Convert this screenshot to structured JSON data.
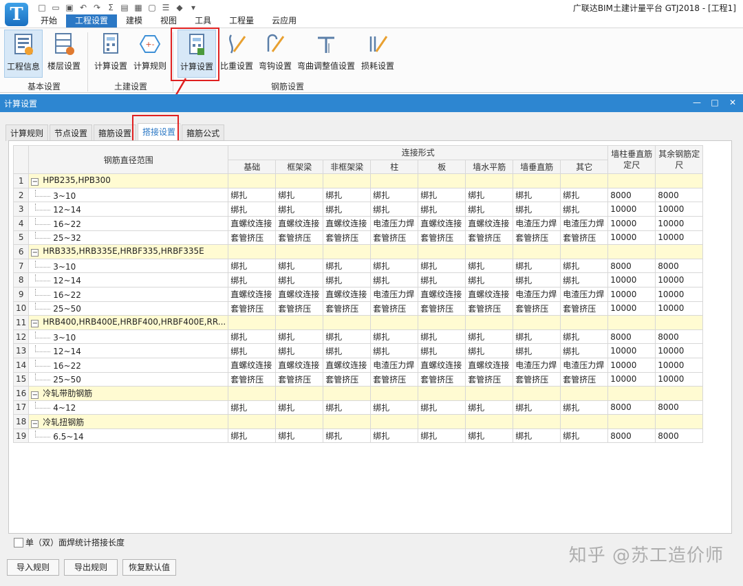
{
  "app": {
    "title": "广联达BIM土建计量平台 GTJ2018 - [工程1]",
    "logo_letter": "T",
    "menu_tabs": [
      "开始",
      "工程设置",
      "建模",
      "视图",
      "工具",
      "工程量",
      "云应用"
    ],
    "active_menu_tab": "工程设置"
  },
  "ribbon": {
    "buttons": [
      {
        "label": "工程信息",
        "icon": "project-info-icon"
      },
      {
        "label": "楼层设置",
        "icon": "floor-settings-icon"
      },
      {
        "label": "计算设置",
        "icon": "calc-settings-icon"
      },
      {
        "label": "计算规则",
        "icon": "calc-rules-icon"
      },
      {
        "label": "计算设置",
        "icon": "rebar-calc-settings-icon"
      },
      {
        "label": "比重设置",
        "icon": "density-settings-icon"
      },
      {
        "label": "弯钩设置",
        "icon": "hook-settings-icon"
      },
      {
        "label": "弯曲调整值设置",
        "icon": "bend-adjust-icon"
      },
      {
        "label": "损耗设置",
        "icon": "loss-settings-icon"
      }
    ],
    "groups": [
      "基本设置",
      "土建设置",
      "钢筋设置"
    ]
  },
  "dialog": {
    "title": "计算设置",
    "tabs": [
      "计算规则",
      "节点设置",
      "箍筋设置",
      "搭接设置",
      "箍筋公式"
    ],
    "active_tab": "搭接设置",
    "header": {
      "range_col": "钢筋直径范围",
      "conn_group": "连接形式",
      "conn_cols": [
        "基础",
        "框架梁",
        "非框架梁",
        "柱",
        "板",
        "墙水平筋",
        "墙垂直筋",
        "其它"
      ],
      "wall_col_l1": "墙柱垂直筋",
      "wall_col_l2": "定尺",
      "other_col_l1": "其余钢筋定",
      "other_col_l2": "尺"
    },
    "rows": [
      {
        "n": "1",
        "group": true,
        "name": "HPB235,HPB300"
      },
      {
        "n": "2",
        "name": "3~10",
        "vals": [
          "绑扎",
          "绑扎",
          "绑扎",
          "绑扎",
          "绑扎",
          "绑扎",
          "绑扎",
          "绑扎",
          "8000",
          "8000"
        ]
      },
      {
        "n": "3",
        "name": "12~14",
        "vals": [
          "绑扎",
          "绑扎",
          "绑扎",
          "绑扎",
          "绑扎",
          "绑扎",
          "绑扎",
          "绑扎",
          "10000",
          "10000"
        ]
      },
      {
        "n": "4",
        "name": "16~22",
        "vals": [
          "直螺纹连接",
          "直螺纹连接",
          "直螺纹连接",
          "电渣压力焊",
          "直螺纹连接",
          "直螺纹连接",
          "电渣压力焊",
          "电渣压力焊",
          "10000",
          "10000"
        ]
      },
      {
        "n": "5",
        "name": "25~32",
        "vals": [
          "套管挤压",
          "套管挤压",
          "套管挤压",
          "套管挤压",
          "套管挤压",
          "套管挤压",
          "套管挤压",
          "套管挤压",
          "10000",
          "10000"
        ]
      },
      {
        "n": "6",
        "group": true,
        "name": "HRB335,HRB335E,HRBF335,HRBF335E"
      },
      {
        "n": "7",
        "name": "3~10",
        "vals": [
          "绑扎",
          "绑扎",
          "绑扎",
          "绑扎",
          "绑扎",
          "绑扎",
          "绑扎",
          "绑扎",
          "8000",
          "8000"
        ]
      },
      {
        "n": "8",
        "name": "12~14",
        "vals": [
          "绑扎",
          "绑扎",
          "绑扎",
          "绑扎",
          "绑扎",
          "绑扎",
          "绑扎",
          "绑扎",
          "10000",
          "10000"
        ]
      },
      {
        "n": "9",
        "name": "16~22",
        "vals": [
          "直螺纹连接",
          "直螺纹连接",
          "直螺纹连接",
          "电渣压力焊",
          "直螺纹连接",
          "直螺纹连接",
          "电渣压力焊",
          "电渣压力焊",
          "10000",
          "10000"
        ]
      },
      {
        "n": "10",
        "name": "25~50",
        "vals": [
          "套管挤压",
          "套管挤压",
          "套管挤压",
          "套管挤压",
          "套管挤压",
          "套管挤压",
          "套管挤压",
          "套管挤压",
          "10000",
          "10000"
        ]
      },
      {
        "n": "11",
        "group": true,
        "name": "HRB400,HRB400E,HRBF400,HRBF400E,RR..."
      },
      {
        "n": "12",
        "name": "3~10",
        "vals": [
          "绑扎",
          "绑扎",
          "绑扎",
          "绑扎",
          "绑扎",
          "绑扎",
          "绑扎",
          "绑扎",
          "8000",
          "8000"
        ]
      },
      {
        "n": "13",
        "name": "12~14",
        "vals": [
          "绑扎",
          "绑扎",
          "绑扎",
          "绑扎",
          "绑扎",
          "绑扎",
          "绑扎",
          "绑扎",
          "10000",
          "10000"
        ]
      },
      {
        "n": "14",
        "name": "16~22",
        "vals": [
          "直螺纹连接",
          "直螺纹连接",
          "直螺纹连接",
          "电渣压力焊",
          "直螺纹连接",
          "直螺纹连接",
          "电渣压力焊",
          "电渣压力焊",
          "10000",
          "10000"
        ]
      },
      {
        "n": "15",
        "name": "25~50",
        "vals": [
          "套管挤压",
          "套管挤压",
          "套管挤压",
          "套管挤压",
          "套管挤压",
          "套管挤压",
          "套管挤压",
          "套管挤压",
          "10000",
          "10000"
        ]
      },
      {
        "n": "16",
        "group": true,
        "name": "冷轧带肋钢筋"
      },
      {
        "n": "17",
        "name": "4~12",
        "vals": [
          "绑扎",
          "绑扎",
          "绑扎",
          "绑扎",
          "绑扎",
          "绑扎",
          "绑扎",
          "绑扎",
          "8000",
          "8000"
        ]
      },
      {
        "n": "18",
        "group": true,
        "name": "冷轧扭钢筋"
      },
      {
        "n": "19",
        "name": "6.5~14",
        "vals": [
          "绑扎",
          "绑扎",
          "绑扎",
          "绑扎",
          "绑扎",
          "绑扎",
          "绑扎",
          "绑扎",
          "8000",
          "8000"
        ]
      }
    ],
    "checkbox_label": "单（双）面焊统计搭接长度",
    "buttons": [
      "导入规则",
      "导出规则",
      "恢复默认值"
    ]
  },
  "watermark": "知乎 @苏工造价师",
  "colors": {
    "accent": "#2b78c5",
    "title_bar": "#2d86d1",
    "group_row": "#fffbd2",
    "highlight_box": "#e02020"
  }
}
